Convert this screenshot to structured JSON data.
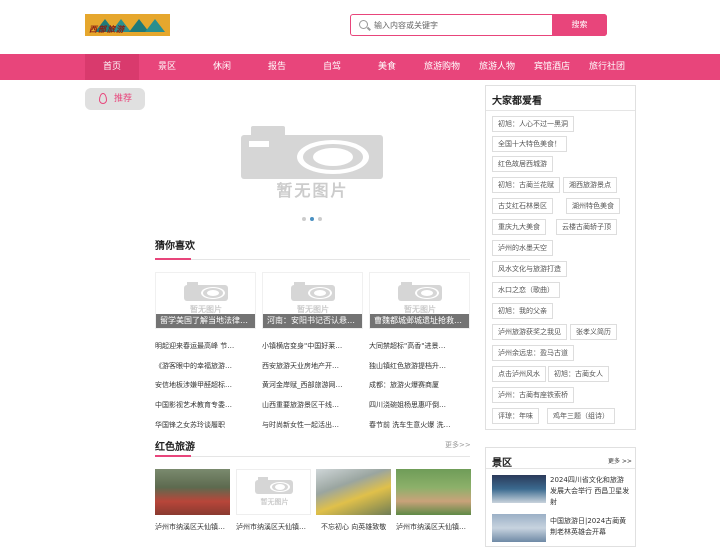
{
  "header": {
    "logo_text": "西部旅游",
    "search_placeholder": "输入内容或关键字",
    "search_button": "搜索"
  },
  "nav": {
    "items": [
      "首页",
      "景区",
      "休闲",
      "报告",
      "自驾",
      "美食",
      "旅游购物",
      "旅游人物",
      "宾馆酒店",
      "旅行社团"
    ]
  },
  "recommend_tab": "推荐",
  "placeholder_text": "暂无图片",
  "guess": {
    "title": "猜你喜欢",
    "cards": [
      "留学美国了解当地法律…",
      "河南：安阳书记否认悬…",
      "曹魏都城邺城遗址抢救…"
    ],
    "col1": [
      "明起迎来春运最高峰 节…",
      "《游客眼中的幸福旅游…",
      "安信地板涉嫌甲醛超标…",
      "中国影视艺术教育专委…",
      "华国锋之女苏玲谈履职"
    ],
    "col2": [
      "小镇横店变身\"中国好莱…",
      "西安旅游天业房地产开…",
      "黄河金岸赋_西部旅游网…",
      "山西重要旅游景区干线…",
      "与时尚新女性一起活出…"
    ],
    "col3": [
      "大同禁超标\"高香\"进景…",
      "独山镇红色旅游提档升…",
      "成都：旅游火爆赛商厦",
      "四川浇碗姐杨思惠吓倒…",
      "春节前 洗车生意火爆 洗…"
    ]
  },
  "red": {
    "title": "红色旅游",
    "more": "更多>>",
    "items": [
      "泸州市纳溪区天仙镇…",
      "泸州市纳溪区天仙镇…",
      "不忘初心 向英雄致敬",
      "泸州市纳溪区天仙镇…"
    ]
  },
  "popular": {
    "title": "大家都爱看",
    "tags": [
      [
        "初旭：人心不过一黑洞"
      ],
      [
        "全国十大特色美食！"
      ],
      [
        "红色故居西城游"
      ],
      [
        "初旭：古蔺兰花赋",
        "湘西旅游景点"
      ],
      [
        "古艾红石林景区",
        "湖州特色美食"
      ],
      [
        "重庆九大美食",
        "云楼古蔺轿子顶"
      ],
      [
        "泸州的水墨天空"
      ],
      [
        "风水文化与旅游打造"
      ],
      [
        "水口之恋（歌曲）"
      ],
      [
        "初旭：我的父亲"
      ],
      [
        "泸州旅游获奖之我见",
        "张孝义简历"
      ],
      [
        "泸州余远忠：盈马古道"
      ],
      [
        "点击泸州风水",
        "初旭：古蔺女人"
      ],
      [
        "泸州：古蔺有座铁索桥"
      ],
      [
        "评琼：年味",
        "鸡年三题（组诗）"
      ]
    ]
  },
  "scenic": {
    "title": "景区",
    "more": "更多 >>",
    "items": [
      "2024四川省文化和旅游发展大会举行 西昌卫星发射",
      "中国旅游日|2024古蔺黄荆老林英雄会开幕"
    ]
  },
  "colors": {
    "accent": "#e8457b",
    "nav_active": "#d93a6d"
  }
}
